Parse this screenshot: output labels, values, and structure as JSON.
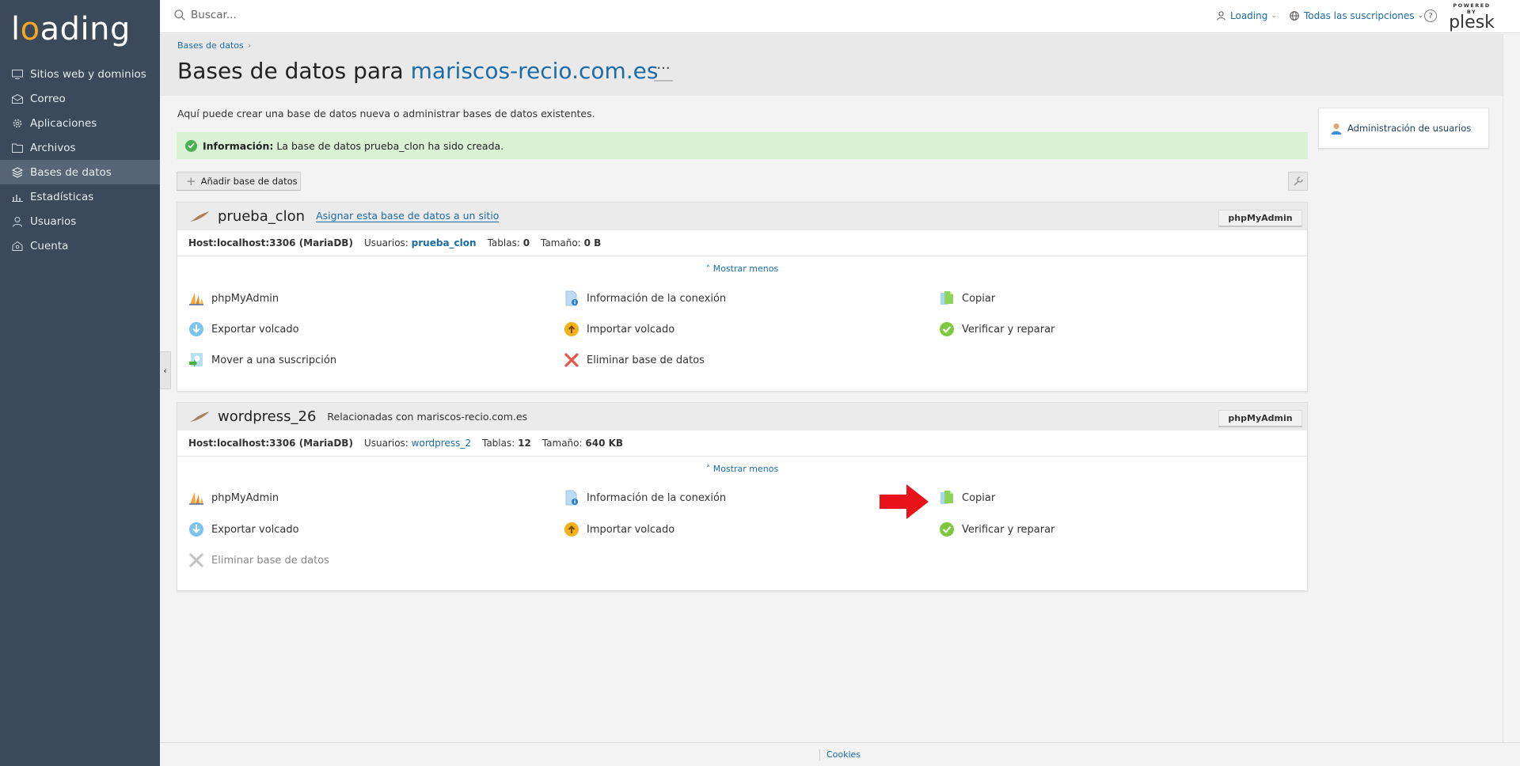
{
  "brand": {
    "logo_pre": "l",
    "logo_o": "o",
    "logo_post": "ading"
  },
  "sidebar": {
    "items": [
      {
        "label": "Sitios web y dominios",
        "icon": "monitor-icon",
        "active": false
      },
      {
        "label": "Correo",
        "icon": "mail-icon",
        "active": false
      },
      {
        "label": "Aplicaciones",
        "icon": "gear-icon",
        "active": false
      },
      {
        "label": "Archivos",
        "icon": "folder-icon",
        "active": false
      },
      {
        "label": "Bases de datos",
        "icon": "layers-icon",
        "active": true
      },
      {
        "label": "Estadísticas",
        "icon": "bar-chart-icon",
        "active": false
      },
      {
        "label": "Usuarios",
        "icon": "user-icon",
        "active": false
      },
      {
        "label": "Cuenta",
        "icon": "account-icon",
        "active": false
      }
    ],
    "collapse_glyph": "‹"
  },
  "topbar": {
    "search_placeholder": "Buscar...",
    "user_label": "Loading",
    "subscriptions_label": "Todas las suscripciones",
    "help_glyph": "?",
    "powered_by": "POWERED BY",
    "plesk": "plesk"
  },
  "header": {
    "breadcrumb": "Bases de datos",
    "breadcrumb_sep": "›",
    "title_prefix": "Bases de datos para",
    "title_domain": "mariscos-recio.com.es",
    "more_glyph": "···"
  },
  "main": {
    "intro": "Aquí puede crear una base de datos nueva o administrar bases de datos existentes.",
    "info_label": "Información:",
    "info_text": "La base de datos prueba_clon ha sido creada.",
    "add_db_label": "Añadir base de datos",
    "add_db_glyph": "+"
  },
  "databases": [
    {
      "name": "prueba_clon",
      "assign_link": "Asignar esta base de datos a un sitio",
      "related": "",
      "pma_button": "phpMyAdmin",
      "host": "Host:localhost:3306 (MariaDB)",
      "users_label": "Usuarios:",
      "users_value": "prueba_clon",
      "tables_label": "Tablas:",
      "tables_value": "0",
      "size_label": "Tamaño:",
      "size_value": "0 B",
      "show_less": "˄ Mostrar menos",
      "actions": {
        "phpmyadmin": "phpMyAdmin",
        "connection_info": "Información de la conexión",
        "copy": "Copiar",
        "export": "Exportar volcado",
        "import": "Importar volcado",
        "check_repair": "Verificar y reparar",
        "move": "Mover a una suscripción",
        "delete": "Eliminar base de datos"
      }
    },
    {
      "name": "wordpress_26",
      "assign_link": "",
      "related": "Relacionadas con mariscos-recio.com.es",
      "pma_button": "phpMyAdmin",
      "host": "Host:localhost:3306 (MariaDB)",
      "users_label": "Usuarios:",
      "users_value": "wordpress_2",
      "tables_label": "Tablas:",
      "tables_value": "12",
      "size_label": "Tamaño:",
      "size_value": "640 KB",
      "show_less": "˄ Mostrar menos",
      "actions": {
        "phpmyadmin": "phpMyAdmin",
        "connection_info": "Información de la conexión",
        "copy": "Copiar",
        "export": "Exportar volcado",
        "import": "Importar volcado",
        "check_repair": "Verificar y reparar",
        "delete": "Eliminar base de datos"
      }
    }
  ],
  "right_panel": {
    "user_admin": "Administración de usuarios"
  },
  "footer": {
    "cookies": "Cookies"
  },
  "colors": {
    "sidebar_bg": "#3a4a5a",
    "accent": "#1b6ca8",
    "success_bg": "#d9f2d4",
    "arrow": "#e8121b"
  }
}
